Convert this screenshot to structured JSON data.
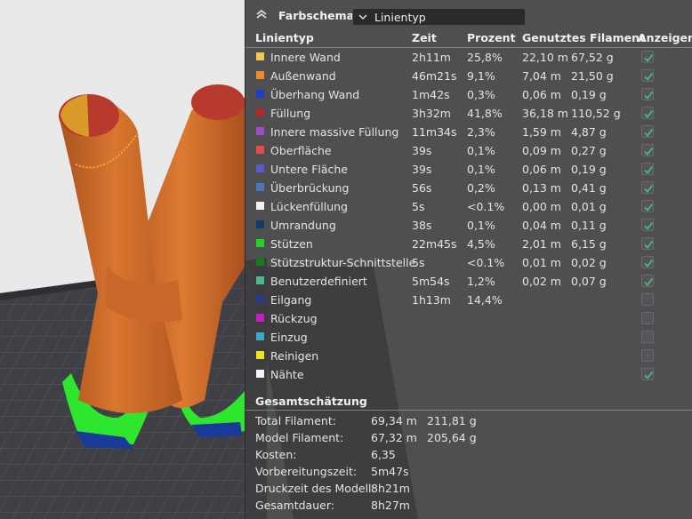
{
  "header": {
    "title": "Farbschema",
    "mode_value": "Linientyp",
    "chevron_icon": "chevron-up-icon"
  },
  "columns": {
    "type": "Linientyp",
    "time": "Zeit",
    "percent": "Prozent",
    "used": "Genutztes Filament",
    "show": "Anzeigen"
  },
  "rows": [
    {
      "name": "Innere Wand",
      "color": "#f2c94c",
      "time": "2h11m",
      "percent": "25,8%",
      "length": "22,10 m",
      "weight": "67,52 g",
      "visible": true
    },
    {
      "name": "Außenwand",
      "color": "#f08a2e",
      "time": "46m21s",
      "percent": "9,1%",
      "length": "7,04 m",
      "weight": "21,50 g",
      "visible": true
    },
    {
      "name": "Überhang Wand",
      "color": "#1e3ccc",
      "time": "1m42s",
      "percent": "0,3%",
      "length": "0,06 m",
      "weight": "0,19 g",
      "visible": true
    },
    {
      "name": "Füllung",
      "color": "#b02a2a",
      "time": "3h32m",
      "percent": "41,8%",
      "length": "36,18 m",
      "weight": "110,52 g",
      "visible": true
    },
    {
      "name": "Innere massive Füllung",
      "color": "#9b4fc4",
      "time": "11m34s",
      "percent": "2,3%",
      "length": "1,59 m",
      "weight": "4,87 g",
      "visible": true
    },
    {
      "name": "Oberfläche",
      "color": "#e84a4a",
      "time": "39s",
      "percent": "0,1%",
      "length": "0,09 m",
      "weight": "0,27 g",
      "visible": true
    },
    {
      "name": "Untere Fläche",
      "color": "#5a5ac8",
      "time": "39s",
      "percent": "0,1%",
      "length": "0,06 m",
      "weight": "0,19 g",
      "visible": true
    },
    {
      "name": "Überbrückung",
      "color": "#4a78b8",
      "time": "56s",
      "percent": "0,2%",
      "length": "0,13 m",
      "weight": "0,41 g",
      "visible": true
    },
    {
      "name": "Lückenfüllung",
      "color": "#f2f2f2",
      "time": "5s",
      "percent": "<0.1%",
      "length": "0,00 m",
      "weight": "0,01 g",
      "visible": true
    },
    {
      "name": "Umrandung",
      "color": "#123a6a",
      "time": "38s",
      "percent": "0,1%",
      "length": "0,04 m",
      "weight": "0,11 g",
      "visible": true
    },
    {
      "name": "Stützen",
      "color": "#22d422",
      "time": "22m45s",
      "percent": "4,5%",
      "length": "2,01 m",
      "weight": "6,15 g",
      "visible": true
    },
    {
      "name": "Stützstruktur-Schnittstelle",
      "color": "#1a7a1a",
      "time": "5s",
      "percent": "<0.1%",
      "length": "0,01 m",
      "weight": "0,02 g",
      "visible": true
    },
    {
      "name": "Benutzerdefiniert",
      "color": "#4fb88a",
      "time": "5m54s",
      "percent": "1,2%",
      "length": "0,02 m",
      "weight": "0,07 g",
      "visible": true
    },
    {
      "name": "Eilgang",
      "color": "#2a3a8a",
      "time": "1h13m",
      "percent": "14,4%",
      "length": "",
      "weight": "",
      "visible": false
    },
    {
      "name": "Rückzug",
      "color": "#c21ec2",
      "time": "",
      "percent": "",
      "length": "",
      "weight": "",
      "visible": false
    },
    {
      "name": "Einzug",
      "color": "#3aa8c8",
      "time": "",
      "percent": "",
      "length": "",
      "weight": "",
      "visible": false
    },
    {
      "name": "Reinigen",
      "color": "#f2e21e",
      "time": "",
      "percent": "",
      "length": "",
      "weight": "",
      "visible": false
    },
    {
      "name": "Nähte",
      "color": "#f5f5f5",
      "time": "",
      "percent": "",
      "length": "",
      "weight": "",
      "visible": true
    }
  ],
  "summary": {
    "title": "Gesamtschätzung",
    "items": [
      {
        "label": "Total Filament:",
        "v1": "69,34 m",
        "v2": "211,81 g"
      },
      {
        "label": "Model Filament:",
        "v1": "67,32 m",
        "v2": "205,64 g"
      },
      {
        "label": "Kosten:",
        "v1": "6,35",
        "v2": ""
      },
      {
        "label": "Vorbereitungszeit:",
        "v1": "5m47s",
        "v2": ""
      },
      {
        "label": "Druckzeit des Modell:",
        "v1": "8h21m",
        "v2": ""
      },
      {
        "label": "Gesamtdauer:",
        "v1": "8h27m",
        "v2": ""
      }
    ]
  }
}
